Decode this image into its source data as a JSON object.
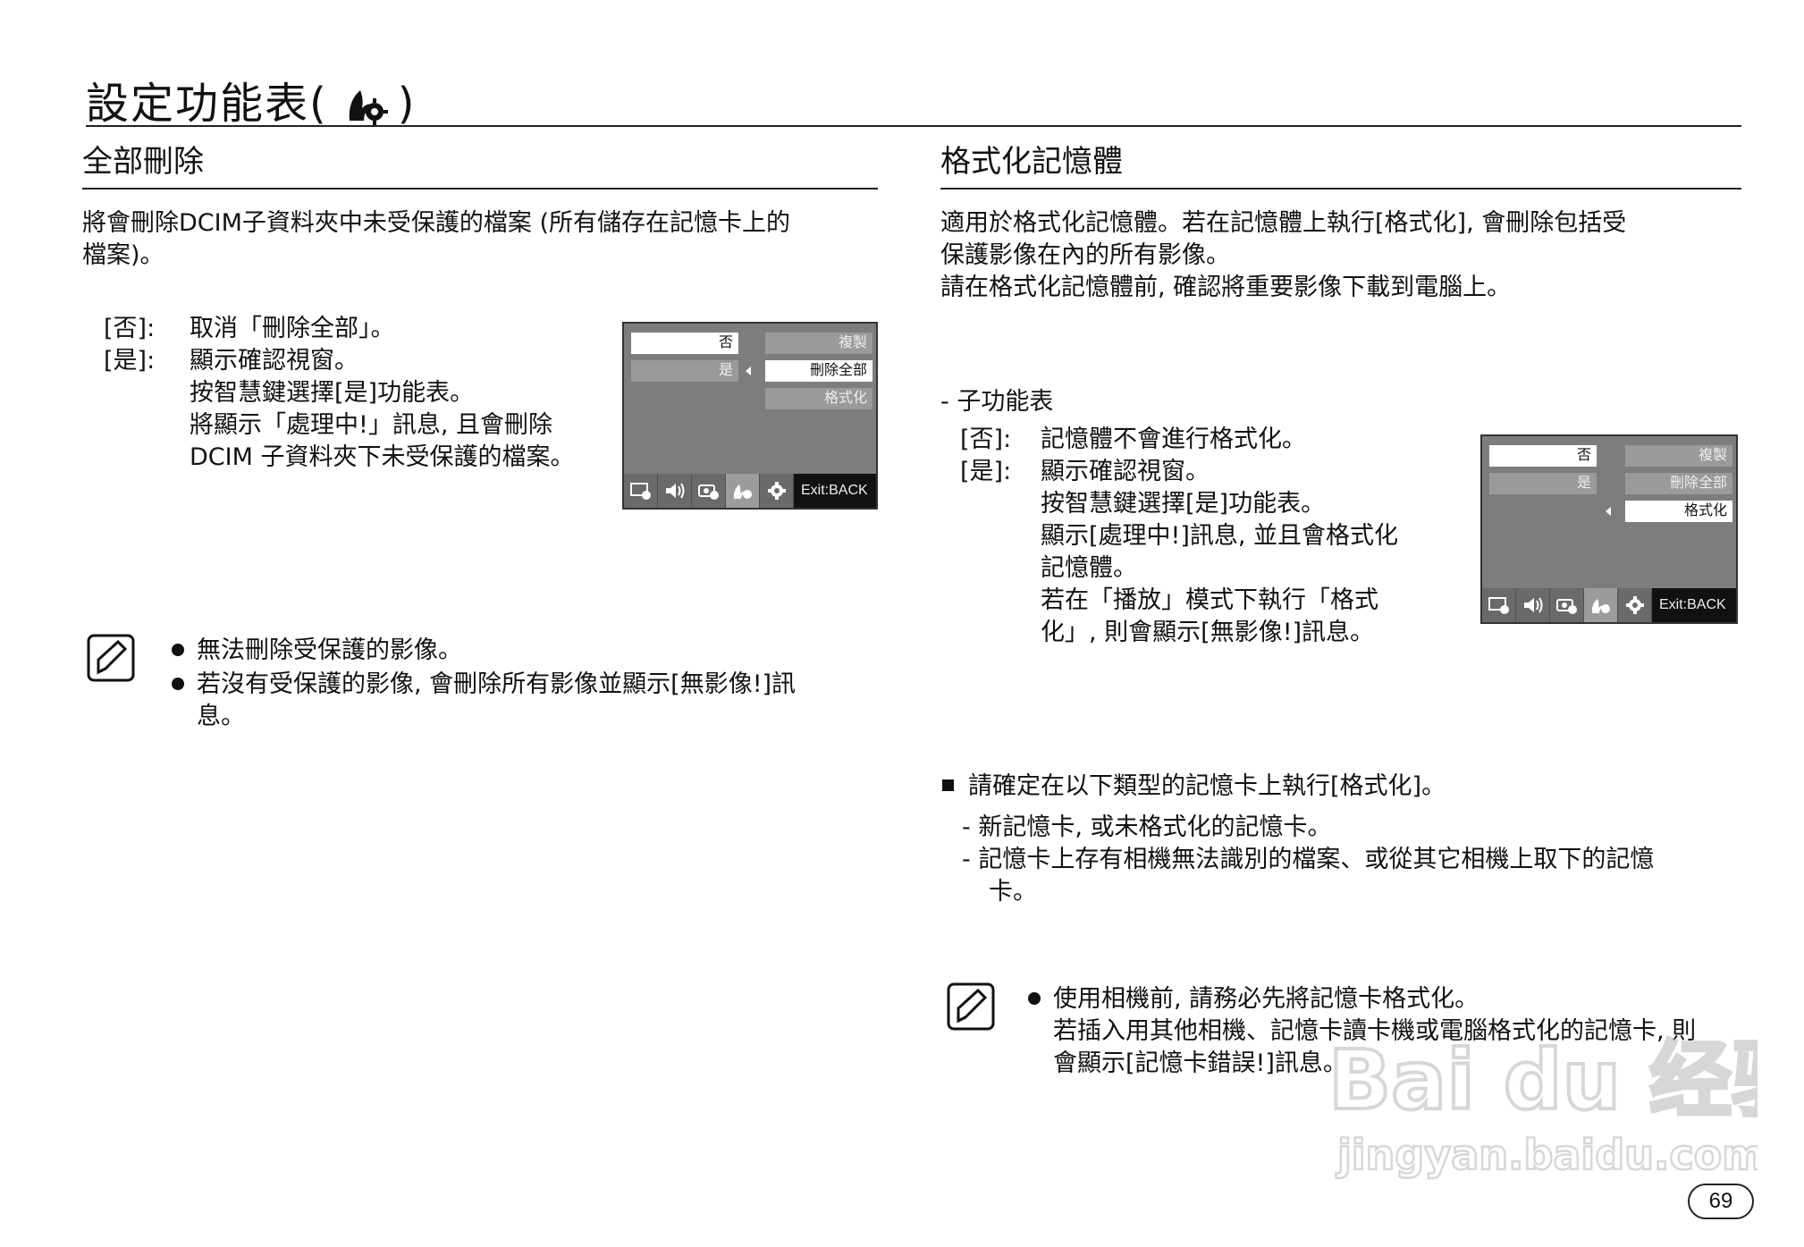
{
  "page": {
    "title": "設定功能表(",
    "title_close": ")",
    "page_number": "69"
  },
  "left": {
    "heading": "全部刪除",
    "intro": [
      "將會刪除DCIM子資料夾中未受保護的檔案 (所有儲存在記憶卡上的",
      "檔案)。"
    ],
    "options": [
      {
        "key": "[否]:",
        "lines": [
          "取消「刪除全部」。"
        ]
      },
      {
        "key": "[是]:",
        "lines": [
          "顯示確認視窗。",
          "按智慧鍵選擇[是]功能表。",
          "將顯示「處理中!」訊息, 且會刪除",
          "DCIM 子資料夾下未受保護的檔案。"
        ]
      }
    ],
    "menu": {
      "no": "否",
      "yes": "是",
      "items": [
        "複製",
        "刪除全部",
        "格式化"
      ],
      "exit": "Exit:BACK"
    },
    "notes": [
      [
        "無法刪除受保護的影像。"
      ],
      [
        "若沒有受保護的影像, 會刪除所有影像並顯示[無影像!]訊",
        "息。"
      ]
    ]
  },
  "right": {
    "heading": "格式化記憶體",
    "intro": [
      "適用於格式化記憶體。若在記憶體上執行[格式化], 會刪除包括受",
      "保護影像在內的所有影像。",
      "請在格式化記憶體前, 確認將重要影像下載到電腦上。"
    ],
    "submenu_label": "- 子功能表",
    "options": [
      {
        "key": "[否]:",
        "lines": [
          "記憶體不會進行格式化。"
        ]
      },
      {
        "key": "[是]:",
        "lines": [
          "顯示確認視窗。",
          "按智慧鍵選擇[是]功能表。",
          "顯示[處理中!]訊息, 並且會格式化",
          "記憶體。",
          "若在「播放」模式下執行「格式",
          "化」, 則會顯示[無影像!]訊息。"
        ]
      }
    ],
    "menu": {
      "no": "否",
      "yes": "是",
      "items": [
        "複製",
        "刪除全部",
        "格式化"
      ],
      "exit": "Exit:BACK"
    },
    "square_bullet": "請確定在以下類型的記憶卡上執行[格式化]。",
    "dash_items": [
      [
        "- 新記憶卡, 或未格式化的記憶卡。"
      ],
      [
        "- 記憶卡上存有相機無法識別的檔案、或從其它相機上取下的記憶",
        "卡。"
      ]
    ],
    "note": [
      "使用相機前, 請務必先將記憶卡格式化。",
      "若插入用其他相機、記憶卡讀卡機或電腦格式化的記憶卡, 則",
      "會顯示[記憶卡錯誤!]訊息。"
    ]
  },
  "watermark": {
    "line1": "Bai du 经验",
    "line2": "jingyan.baidu.com"
  }
}
